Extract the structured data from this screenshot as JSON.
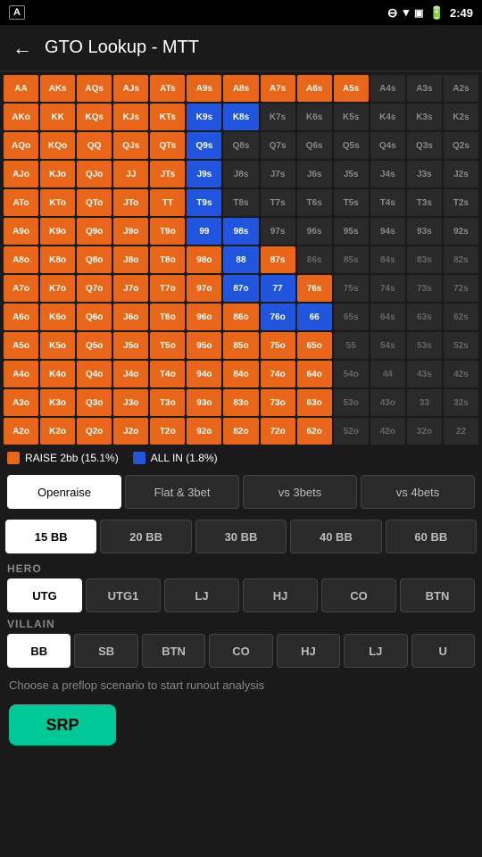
{
  "statusBar": {
    "time": "2:49",
    "leftIcon": "A"
  },
  "header": {
    "backLabel": "←",
    "title": "GTO Lookup - MTT"
  },
  "legend": {
    "raise2bb": "RAISE 2bb (15.1%)",
    "allIn": "ALL IN (1.8%)"
  },
  "actionTabs": [
    {
      "id": "openraise",
      "label": "Openraise",
      "active": true
    },
    {
      "id": "flat3bet",
      "label": "Flat & 3bet",
      "active": false
    },
    {
      "id": "vs3bets",
      "label": "vs 3bets",
      "active": false
    },
    {
      "id": "vs4bets",
      "label": "vs 4bets",
      "active": false
    }
  ],
  "bbOptions": [
    {
      "label": "15 BB",
      "active": true
    },
    {
      "label": "20 BB",
      "active": false
    },
    {
      "label": "30 BB",
      "active": false
    },
    {
      "label": "40 BB",
      "active": false
    },
    {
      "label": "60 BB",
      "active": false
    }
  ],
  "heroLabel": "HERO",
  "heroPositions": [
    {
      "label": "UTG",
      "active": true
    },
    {
      "label": "UTG1",
      "active": false
    },
    {
      "label": "LJ",
      "active": false
    },
    {
      "label": "HJ",
      "active": false
    },
    {
      "label": "CO",
      "active": false
    },
    {
      "label": "BTN",
      "active": false
    }
  ],
  "villainLabel": "VILLAIN",
  "villainPositions": [
    {
      "label": "BB",
      "active": true
    },
    {
      "label": "SB",
      "active": false
    },
    {
      "label": "BTN",
      "active": false
    },
    {
      "label": "CO",
      "active": false
    },
    {
      "label": "HJ",
      "active": false
    },
    {
      "label": "LJ",
      "active": false
    },
    {
      "label": "U",
      "active": false
    }
  ],
  "infoText": "Choose a preflop scenario to start runout analysis",
  "srpLabel": "SRP",
  "grid": [
    [
      "AA",
      "AKs",
      "AQs",
      "AJs",
      "ATs",
      "A9s",
      "A8s",
      "A7s",
      "A6s",
      "A5s",
      "A4s",
      "A3s",
      "A2s"
    ],
    [
      "AKo",
      "KK",
      "KQs",
      "KJs",
      "KTs",
      "K9s",
      "K8s",
      "K7s",
      "K6s",
      "K5s",
      "K4s",
      "K3s",
      "K2s"
    ],
    [
      "AQo",
      "KQo",
      "QQ",
      "QJs",
      "QTs",
      "Q9s",
      "Q8s",
      "Q7s",
      "Q6s",
      "Q5s",
      "Q4s",
      "Q3s",
      "Q2s"
    ],
    [
      "AJo",
      "KJo",
      "QJo",
      "JJ",
      "JTs",
      "J9s",
      "J8s",
      "J7s",
      "J6s",
      "J5s",
      "J4s",
      "J3s",
      "J2s"
    ],
    [
      "ATo",
      "KTo",
      "QTo",
      "JTo",
      "TT",
      "T9s",
      "T8s",
      "T7s",
      "T6s",
      "T5s",
      "T4s",
      "T3s",
      "T2s"
    ],
    [
      "A9o",
      "K9o",
      "Q9o",
      "J9o",
      "T9o",
      "99",
      "98s",
      "97s",
      "96s",
      "95s",
      "94s",
      "93s",
      "92s"
    ],
    [
      "A8o",
      "K8o",
      "Q8o",
      "J8o",
      "T8o",
      "98o",
      "88",
      "87s",
      "86s",
      "85s",
      "84s",
      "83s",
      "82s"
    ],
    [
      "A7o",
      "K7o",
      "Q7o",
      "J7o",
      "T7o",
      "97o",
      "87o",
      "77",
      "76s",
      "75s",
      "74s",
      "73s",
      "72s"
    ],
    [
      "A6o",
      "K6o",
      "Q6o",
      "J6o",
      "T6o",
      "96o",
      "86o",
      "76o",
      "66",
      "65s",
      "64s",
      "63s",
      "62s"
    ],
    [
      "A5o",
      "K5o",
      "Q5o",
      "J5o",
      "T5o",
      "95o",
      "85o",
      "75o",
      "65o",
      "55",
      "54s",
      "53s",
      "52s"
    ],
    [
      "A4o",
      "K4o",
      "Q4o",
      "J4o",
      "T4o",
      "94o",
      "84o",
      "74o",
      "64o",
      "54o",
      "44",
      "43s",
      "42s"
    ],
    [
      "A3o",
      "K3o",
      "Q3o",
      "J3o",
      "T3o",
      "93o",
      "83o",
      "73o",
      "63o",
      "53o",
      "43o",
      "33",
      "32s"
    ],
    [
      "A2o",
      "K2o",
      "Q2o",
      "J2o",
      "T2o",
      "92o",
      "82o",
      "72o",
      "62o",
      "52o",
      "42o",
      "32o",
      "22"
    ]
  ],
  "gridColors": {
    "orange": [
      "AA",
      "AKs",
      "AQs",
      "AJs",
      "ATs",
      "A9s",
      "A8s",
      "A7s",
      "A6s",
      "A5s",
      "AKo",
      "KK",
      "KQs",
      "KJs",
      "KTs",
      "K9s",
      "K8s",
      "AQo",
      "KQo",
      "QQ",
      "QJs",
      "QTs",
      "Q9s",
      "AJo",
      "KJo",
      "QJo",
      "JJ",
      "JTs",
      "J9s",
      "ATo",
      "KTo",
      "QTo",
      "JTo",
      "TT",
      "T9s",
      "A9o",
      "K9o",
      "Q9o",
      "J9o",
      "T9o",
      "98s",
      "A8o",
      "K8o",
      "Q8o",
      "J8o",
      "T8o",
      "98o",
      "87s",
      "A7o",
      "K7o",
      "Q7o",
      "J7o",
      "T7o",
      "97o",
      "87o",
      "76s",
      "A6o",
      "K6o",
      "Q6o",
      "J6o",
      "T6o",
      "96o",
      "86o",
      "76o",
      "65s",
      "A5o",
      "K5o",
      "Q5o",
      "J5o",
      "T5o",
      "95o",
      "85o",
      "75o",
      "65o",
      "A4o",
      "K4o",
      "Q4o",
      "J4o",
      "T4o",
      "94o",
      "84o",
      "74o",
      "64o",
      "A3o",
      "K3o",
      "Q3o",
      "J3o",
      "T3o",
      "93o",
      "83o",
      "73o",
      "63o",
      "A2o",
      "K2o",
      "Q2o",
      "J2o",
      "T2o",
      "92o",
      "82o",
      "72o",
      "62o"
    ],
    "blue": [
      "K9s",
      "K8s",
      "Q8s",
      "J8s",
      "T8s",
      "88",
      "77",
      "66",
      "99"
    ]
  }
}
